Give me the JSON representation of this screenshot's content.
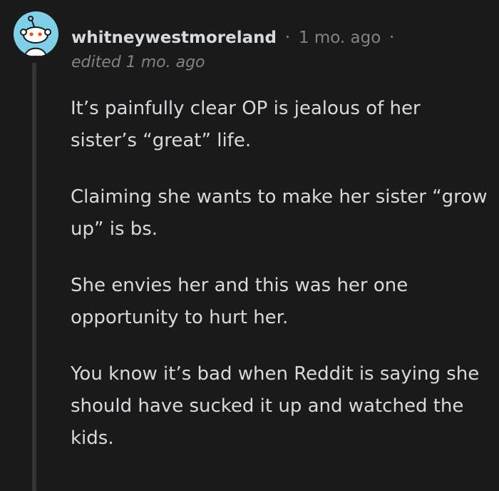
{
  "comment": {
    "author": "whitneywestmoreland",
    "separator": "·",
    "time": "1 mo. ago",
    "trailing_separator": "·",
    "edited": "edited 1 mo. ago",
    "avatar": "reddit-snoo-avatar-icon",
    "avatar_color": "#7fd0e6",
    "paragraphs": [
      "It’s painfully clear OP is jealous of her sister’s “great” life.",
      "Claiming she wants to make her sister “grow up” is bs.",
      "She envies her and this was her one opportunity to hurt her.",
      "You know it’s bad when Reddit is saying she should have sucked it up and watched the kids."
    ]
  },
  "colors": {
    "background": "#1a1a1b",
    "text": "#d7dadc",
    "muted": "#818384",
    "thread_line": "#343536"
  }
}
